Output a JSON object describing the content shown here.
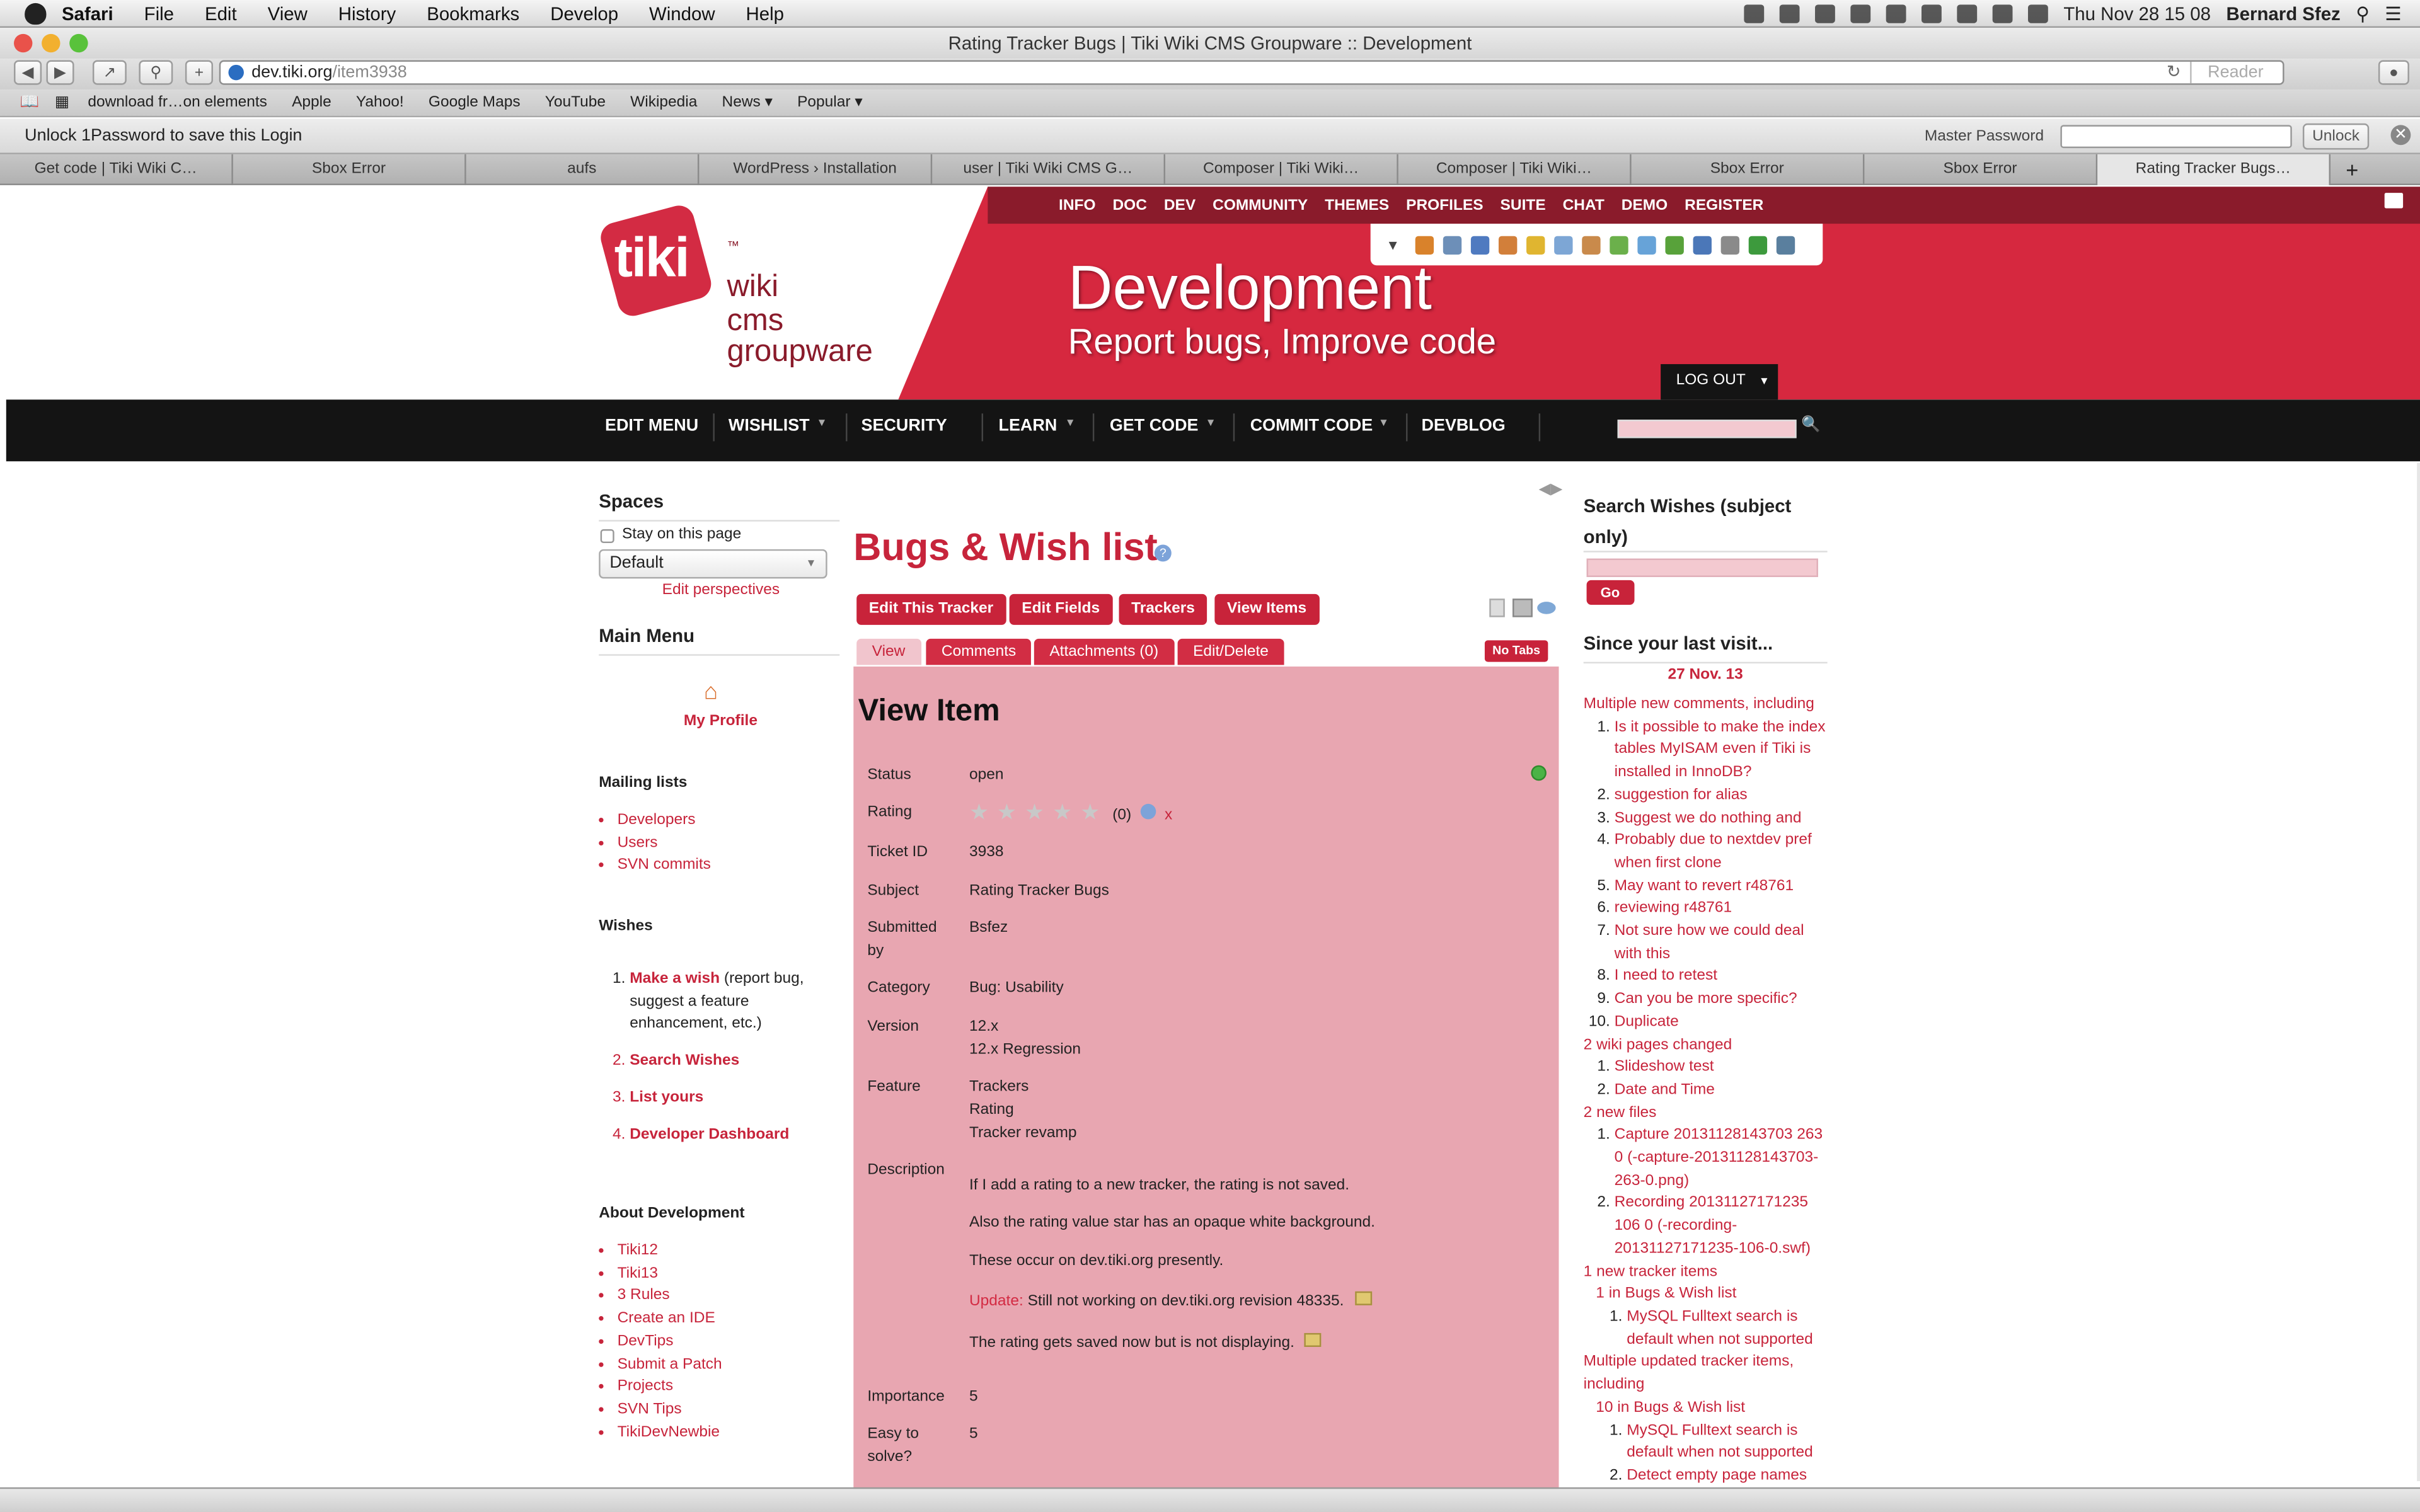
{
  "menubar": {
    "app": "Safari",
    "items": [
      "File",
      "Edit",
      "View",
      "History",
      "Bookmarks",
      "Develop",
      "Window",
      "Help"
    ],
    "clock": "Thu Nov 28  15 08",
    "user": "Bernard Sfez"
  },
  "window": {
    "title": "Rating Tracker Bugs | Tiki Wiki CMS Groupware :: Development",
    "url_host": "dev.tiki.org",
    "url_path": "/item3938",
    "reader": "Reader"
  },
  "bookmarks": [
    "download fr…on elements",
    "Apple",
    "Yahoo!",
    "Google Maps",
    "YouTube",
    "Wikipedia",
    "News ▾",
    "Popular ▾"
  ],
  "onepassword": {
    "message": "Unlock 1Password to save this Login",
    "label": "Master Password",
    "button": "Unlock"
  },
  "tabs": [
    "Get code | Tiki Wiki C…",
    "Sbox Error",
    "aufs",
    "WordPress › Installation",
    "user | Tiki Wiki CMS G…",
    "Composer | Tiki Wiki…",
    "Composer | Tiki Wiki…",
    "Sbox Error",
    "Sbox Error",
    "Rating Tracker Bugs…"
  ],
  "header": {
    "logo_word": "tiki",
    "logo_tm": "™",
    "logo_lines": [
      "wiki",
      "cms",
      "groupware"
    ],
    "title": "Development",
    "subtitle": "Report bugs, Improve code",
    "logout": "LOG OUT",
    "topnav": [
      "INFO",
      "DOC",
      "DEV",
      "COMMUNITY",
      "THEMES",
      "PROFILES",
      "SUITE",
      "CHAT",
      "DEMO",
      "REGISTER"
    ]
  },
  "mainnav": [
    "EDIT MENU",
    "WISHLIST",
    "SECURITY",
    "LEARN",
    "GET CODE",
    "COMMIT CODE",
    "DEVBLOG"
  ],
  "left": {
    "spaces_title": "Spaces",
    "stay": "Stay on this page",
    "perspective": "Default",
    "edit_persp": "Edit perspectives",
    "main_menu": "Main Menu",
    "my_profile": "My Profile",
    "mailing_title": "Mailing lists",
    "mailing": [
      "Developers",
      "Users",
      "SVN commits"
    ],
    "wishes_title": "Wishes",
    "wish_make": "Make a wish",
    "wish_make_rest": " (report bug, suggest a feature enhancement, etc.)",
    "wishes": [
      "Search Wishes",
      "List yours",
      "Developer Dashboard"
    ],
    "about_title": "About Development",
    "about": [
      "Tiki12",
      "Tiki13",
      "3 Rules",
      "Create an IDE",
      "DevTips",
      "Submit a Patch",
      "Projects",
      "SVN Tips",
      "TikiDevNewbie"
    ]
  },
  "center": {
    "page_title": "Bugs & Wish list",
    "buttons": [
      "Edit This Tracker",
      "Edit Fields",
      "Trackers",
      "View Items"
    ],
    "tabs": [
      "View",
      "Comments",
      "Attachments (0)",
      "Edit/Delete"
    ],
    "no_tabs": "No Tabs",
    "heading": "View Item",
    "fields": [
      {
        "label": "Status",
        "value": "open"
      },
      {
        "label": "Rating",
        "value": "(0)"
      },
      {
        "label": "Ticket ID",
        "value": "3938"
      },
      {
        "label": "Subject",
        "value": "Rating Tracker Bugs"
      },
      {
        "label": "Submitted by",
        "value": "Bsfez"
      },
      {
        "label": "Category",
        "value": "Bug: Usability"
      },
      {
        "label": "Version",
        "value": "12.x",
        "value2": "12.x Regression"
      },
      {
        "label": "Feature",
        "value": "Trackers",
        "value2": "Rating",
        "value3": "Tracker revamp"
      },
      {
        "label": "Description"
      },
      {
        "label": "Importance",
        "value": "5"
      },
      {
        "label": "Easy to solve?",
        "value": "5"
      }
    ],
    "rating_x": "x",
    "desc": [
      "If I add a rating to a new tracker, the rating is not saved.",
      "Also the rating value star has an opaque white background.",
      "These occur on dev.tiki.org presently."
    ],
    "update_label": "Update:",
    "update_text": " Still not working on dev.tiki.org revision 48335.",
    "desc_last": "The rating gets saved now but is not displaying."
  },
  "right": {
    "search_title": "Search Wishes (subject only)",
    "go": "Go",
    "since_title": "Since your last visit...",
    "date": "27 Nov. 13",
    "comments_head": "Multiple new comments, including",
    "comments": [
      "Is it possible to make the index tables MyISAM even if Tiki is installed in InnoDB?",
      "suggestion for alias",
      "Suggest we do nothing and",
      "Probably due to nextdev pref when first clone",
      "May want to revert r48761",
      "reviewing r48761",
      "Not sure how we could deal with this",
      "I need to retest",
      "Can you be more specific?",
      "Duplicate"
    ],
    "wiki_head": "2 wiki pages changed",
    "wiki": [
      "Slideshow test",
      "Date and Time"
    ],
    "files_head": "2 new files",
    "files": [
      "Capture 20131128143703 263 0 (-capture-20131128143703-263-0.png)",
      "Recording 20131127171235 106 0 (-recording-20131127171235-106-0.swf)"
    ],
    "tracker_head": "1 new tracker items",
    "tracker_sub": "1 in Bugs & Wish list",
    "tracker_items": [
      "MySQL Fulltext search is default when not supported"
    ],
    "updated_head": "Multiple updated tracker items, including",
    "updated_sub": "10 in Bugs & Wish list",
    "updated_items": [
      "MySQL Fulltext search is default when not supported",
      "Detect empty page names"
    ]
  }
}
